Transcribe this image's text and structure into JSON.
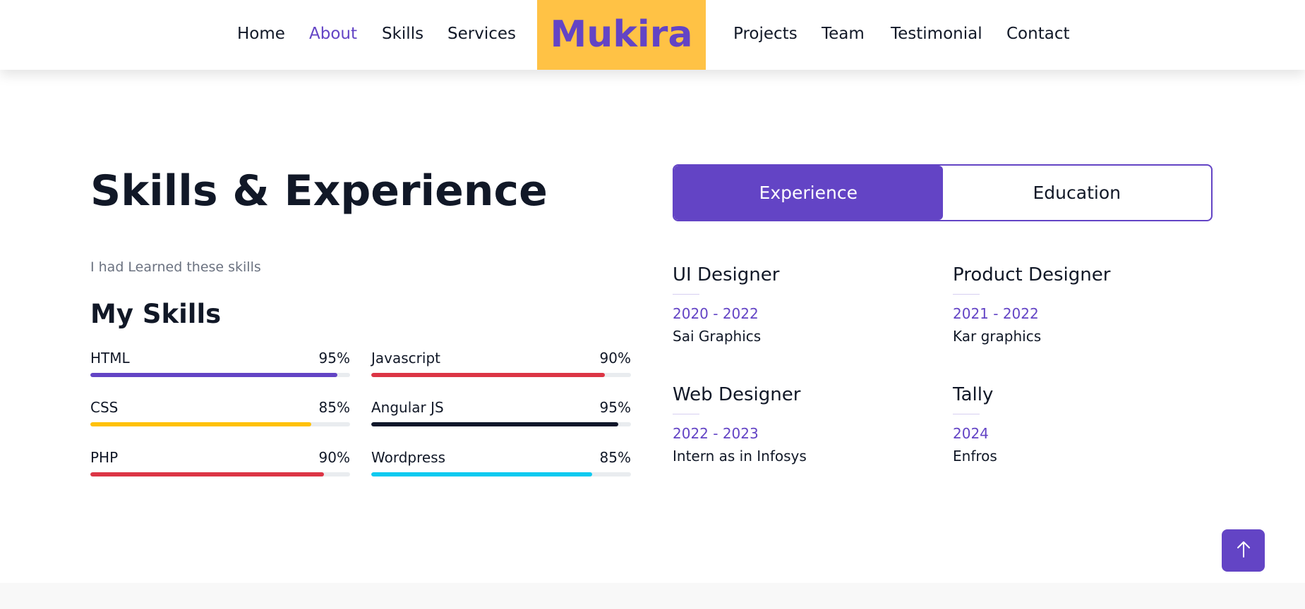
{
  "nav": {
    "left_links": [
      "Home",
      "About",
      "Skills",
      "Services"
    ],
    "brand": "Mukira",
    "right_links": [
      "Projects",
      "Team",
      "Testimonial",
      "Contact"
    ],
    "active": "About"
  },
  "section": {
    "title": "Skills & Experience",
    "subtitle": "I had Learned these skills",
    "skills_heading": "My Skills"
  },
  "skills": [
    {
      "name": "HTML",
      "percent_label": "95%",
      "percent": 95,
      "color": "#6344c5"
    },
    {
      "name": "Javascript",
      "percent_label": "90%",
      "percent": 90,
      "color": "#dc3545"
    },
    {
      "name": "CSS",
      "percent_label": "85%",
      "percent": 85,
      "color": "#ffc107"
    },
    {
      "name": "Angular JS",
      "percent_label": "95%",
      "percent": 95,
      "color": "#0f172a"
    },
    {
      "name": "PHP",
      "percent_label": "90%",
      "percent": 90,
      "color": "#dc3545"
    },
    {
      "name": "Wordpress",
      "percent_label": "85%",
      "percent": 85,
      "color": "#0dcaf0"
    }
  ],
  "tabs": {
    "experience": "Experience",
    "education": "Education",
    "active": "Experience"
  },
  "experience": [
    {
      "role": "UI Designer",
      "years": "2020 - 2022",
      "company": "Sai Graphics"
    },
    {
      "role": "Product Designer",
      "years": "2021 - 2022",
      "company": "Kar graphics"
    },
    {
      "role": "Web Designer",
      "years": "2022 - 2023",
      "company": "Intern as in Infosys"
    },
    {
      "role": "Tally",
      "years": "2024",
      "company": "Enfros"
    }
  ],
  "icons": {
    "back_to_top": "arrow-up-icon"
  },
  "colors": {
    "accent": "#6344c5",
    "brand_bg": "#ffc245"
  }
}
